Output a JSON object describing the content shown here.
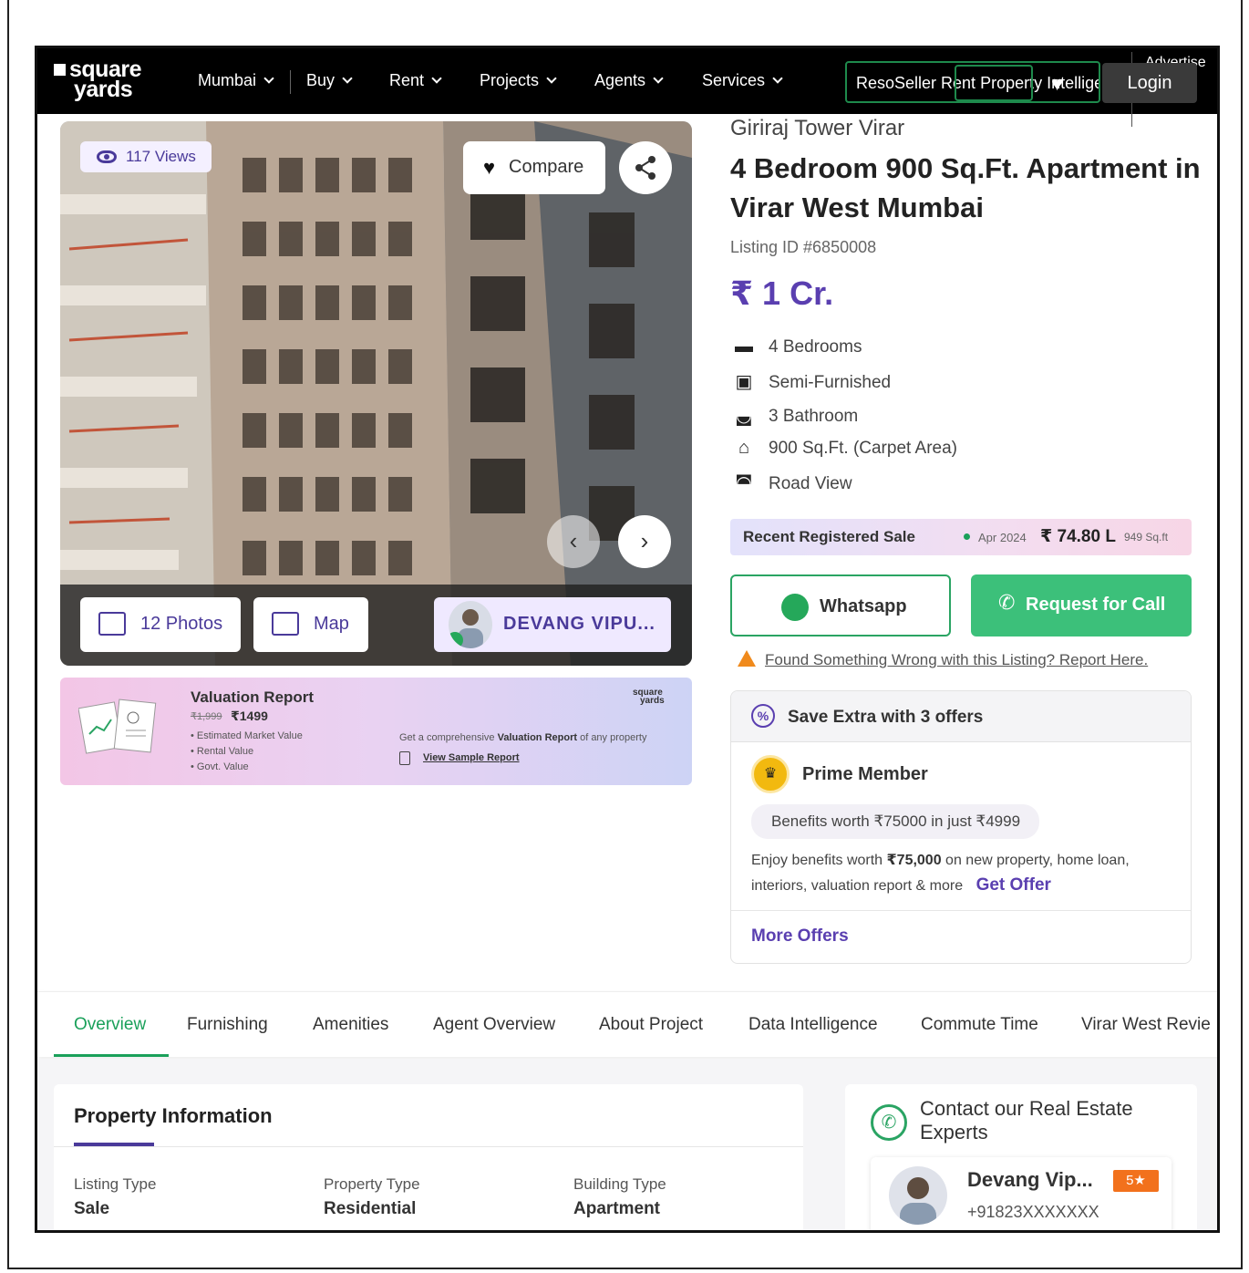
{
  "nav": {
    "logo_line1": "square",
    "logo_line2": "yards",
    "city": "Mumbai",
    "items": [
      "Buy",
      "Rent",
      "Projects",
      "Agents",
      "Services"
    ],
    "resale_badge": "ResoSeller Rent Pr",
    "property_badge": "operty",
    "intel_badge": " Intelligence",
    "advertise": "Advertise with us",
    "login": "Login"
  },
  "gallery": {
    "views": "117 Views",
    "compare": "Compare",
    "photos": "12 Photos",
    "map": "Map",
    "agent_short": "DEVANG VIPU..."
  },
  "valuation": {
    "title": "Valuation Report",
    "old_price": "₹1,999",
    "new_price": "₹1499",
    "items": [
      "• Estimated Market Value",
      "• Rental Value",
      "• Govt. Value"
    ],
    "desc_pre": "Get a comprehensive ",
    "desc_bold": "Valuation Report",
    "desc_post": " of any property",
    "link": "View Sample Report",
    "logo1": "square",
    "logo2": "yards"
  },
  "listing": {
    "project": "Giriraj Tower Virar",
    "title": "4 Bedroom 900 Sq.Ft. Apartment in Virar West Mumbai",
    "listing_id": "Listing ID #6850008",
    "price": "₹ 1 Cr.",
    "features": [
      {
        "icon": "bed-icon",
        "text": "4 Bedrooms"
      },
      {
        "icon": "sofa-icon",
        "text": "Semi-Furnished"
      },
      {
        "icon": "bathtub-icon",
        "text": "3 Bathroom"
      },
      {
        "icon": "home-icon",
        "text": "900 Sq.Ft. (Carpet Area)"
      },
      {
        "icon": "view-icon",
        "text": "Road View"
      }
    ]
  },
  "recent_sale": {
    "label": "Recent Registered Sale",
    "date": "Apr 2024",
    "amount": "₹ 74.80 L",
    "area": "949 Sq.ft"
  },
  "actions": {
    "whatsapp": "Whatsapp",
    "call": "Request for Call",
    "report": "Found Something Wrong with this Listing? Report Here."
  },
  "offers": {
    "heading": "Save Extra with 3 offers",
    "prime": "Prime Member",
    "benefit": "Benefits worth ₹75000 in just ₹4999",
    "enjoy_pre": "Enjoy benefits worth ",
    "enjoy_bold": "₹75,000",
    "enjoy_post": " on new property, home loan, interiors, valuation report & more",
    "get_offer": "Get Offer",
    "more": "More Offers"
  },
  "tabs": [
    "Overview",
    "Furnishing",
    "Amenities",
    "Agent Overview",
    "About Project",
    "Data Intelligence",
    "Commute Time",
    "Virar West Revie"
  ],
  "property_info": {
    "title": "Property Information",
    "fields": [
      {
        "label": "Listing Type",
        "value": "Sale"
      },
      {
        "label": "Property Type",
        "value": "Residential"
      },
      {
        "label": "Building Type",
        "value": "Apartment"
      }
    ]
  },
  "contact": {
    "title": "Contact our Real Estate Experts",
    "agent_name": "Devang Vip...",
    "rating": "5★",
    "phone": "+91823XXXXXXX"
  },
  "colors": {
    "brand_purple": "#5a3fb0",
    "green": "#3cc07a",
    "nav_bg": "#000000"
  }
}
